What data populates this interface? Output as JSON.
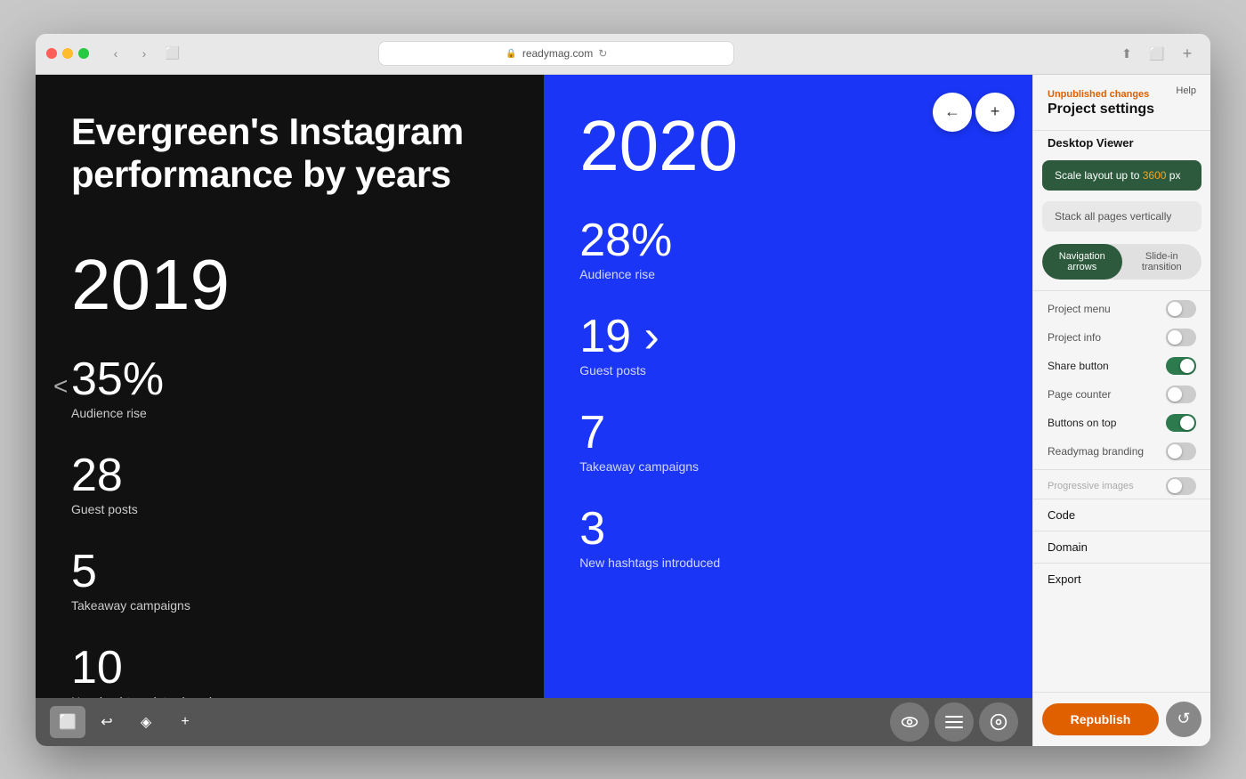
{
  "browser": {
    "url": "readymag.com",
    "lock_icon": "🔒",
    "nav": {
      "back_label": "‹",
      "forward_label": "›",
      "sidebar_label": "⬜",
      "refresh_label": "↻",
      "share_label": "⬆",
      "fullscreen_label": "⬜",
      "add_tab_label": "+"
    }
  },
  "canvas": {
    "left_panel": {
      "background": "#111111",
      "title": "Evergreen's Instagram performance by years",
      "year": "2019",
      "stats": [
        {
          "number": "35%",
          "label": "Audience rise"
        },
        {
          "number": "28",
          "label": "Guest posts"
        },
        {
          "number": "5",
          "label": "Takeaway campaigns"
        },
        {
          "number": "10",
          "label": "New hashtags introduced"
        }
      ],
      "nav_arrow": "<"
    },
    "right_panel": {
      "background": "#1a35f5",
      "year": "2020",
      "stats": [
        {
          "number": "28%",
          "label": "Audience rise"
        },
        {
          "number": "19 ›",
          "label": "Guest posts"
        },
        {
          "number": "7",
          "label": "Takeaway campaigns"
        },
        {
          "number": "3",
          "label": "New hashtags introduced"
        }
      ]
    },
    "nav_controls": {
      "back": "←",
      "forward": "+"
    }
  },
  "toolbar": {
    "buttons": [
      {
        "icon": "⬜",
        "active": true,
        "label": "desktop-view"
      },
      {
        "icon": "↩",
        "active": false,
        "label": "history"
      },
      {
        "icon": "◈",
        "active": false,
        "label": "layers"
      },
      {
        "icon": "+",
        "active": false,
        "label": "add"
      }
    ],
    "bottom_right": [
      {
        "icon": "👁",
        "label": "preview"
      },
      {
        "icon": "≡",
        "label": "menu"
      },
      {
        "icon": "◎",
        "label": "settings"
      }
    ]
  },
  "sidebar": {
    "unpublished_label": "Unpublished changes",
    "help_label": "Help",
    "title": "Project settings",
    "section_viewer": "Desktop Viewer",
    "scale_btn": {
      "text": "Scale layout up to ",
      "value": "3600",
      "unit": " px"
    },
    "stack_btn": "Stack all pages vertically",
    "nav_styles": [
      {
        "label": "Navigation arrows",
        "active": true
      },
      {
        "label": "Slide-in transition",
        "active": false
      }
    ],
    "toggles": [
      {
        "label": "Project menu",
        "on": false,
        "bold": false
      },
      {
        "label": "Project info",
        "on": false,
        "bold": false
      },
      {
        "label": "Share button",
        "on": true,
        "bold": true
      },
      {
        "label": "Page counter",
        "on": false,
        "bold": false
      },
      {
        "label": "Buttons on top",
        "on": true,
        "bold": true
      },
      {
        "label": "Readymag branding",
        "on": false,
        "bold": false
      }
    ],
    "progressive_label": "Progressive images",
    "links": [
      {
        "label": "Code"
      },
      {
        "label": "Domain"
      },
      {
        "label": "Export"
      }
    ],
    "republish_btn": "Republish",
    "undo_icon": "↺"
  }
}
